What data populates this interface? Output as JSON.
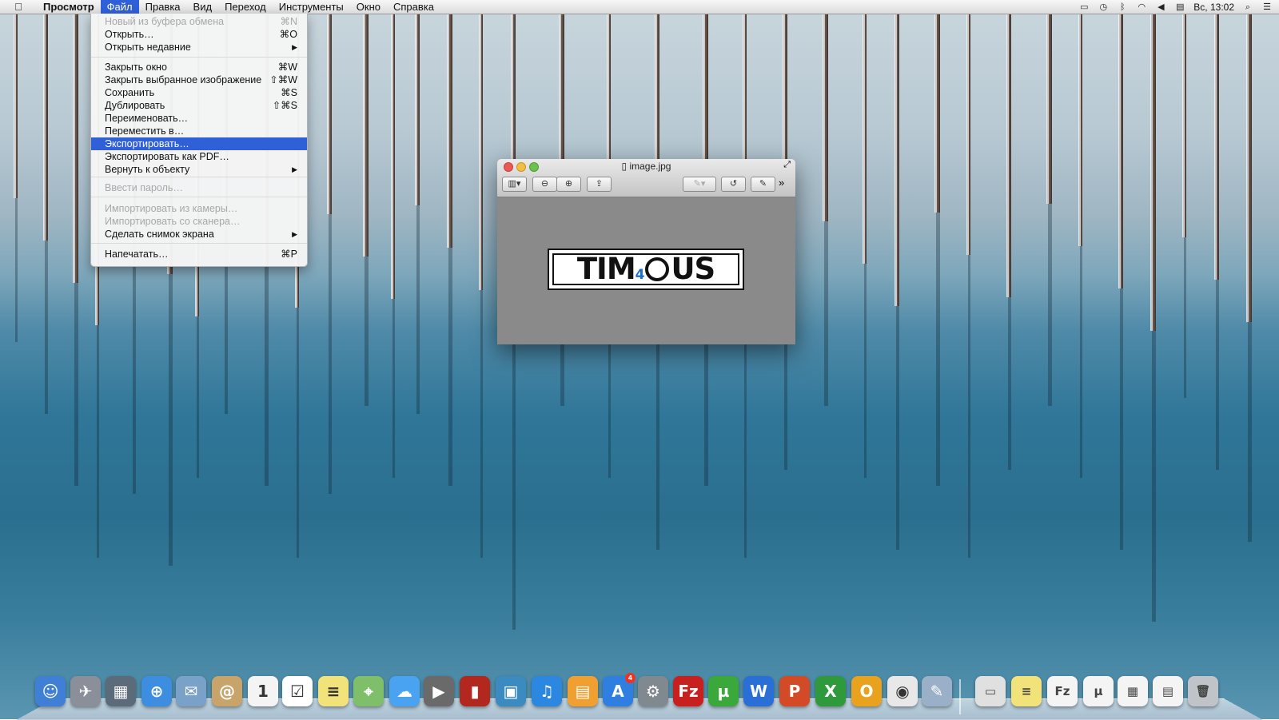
{
  "menubar": {
    "apple_icon": "apple-icon",
    "app_name": "Просмотр",
    "items": [
      "Файл",
      "Правка",
      "Вид",
      "Переход",
      "Инструменты",
      "Окно",
      "Справка"
    ],
    "clock": "Вс, 13:02"
  },
  "file_menu": {
    "items": [
      {
        "label": "Новый из буфера обмена",
        "shortcut": "⌘N",
        "disabled": true
      },
      {
        "label": "Открыть…",
        "shortcut": "⌘O"
      },
      {
        "label": "Открыть недавние",
        "submenu": true
      },
      {
        "label": "Закрыть окно",
        "shortcut": "⌘W"
      },
      {
        "label": "Закрыть выбранное изображение",
        "shortcut": "⇧⌘W"
      },
      {
        "label": "Сохранить",
        "shortcut": "⌘S"
      },
      {
        "label": "Дублировать",
        "shortcut": "⇧⌘S"
      },
      {
        "label": "Переименовать…"
      },
      {
        "label": "Переместить в…"
      },
      {
        "label": "Экспортировать…",
        "highlighted": true
      },
      {
        "label": "Экспортировать как PDF…"
      },
      {
        "label": "Вернуть к объекту",
        "submenu": true
      },
      {
        "label": "Ввести пароль…",
        "disabled": true
      },
      {
        "label": "Импортировать из камеры…",
        "disabled": true
      },
      {
        "label": "Импортировать со сканера…",
        "disabled": true
      },
      {
        "label": "Сделать снимок экрана",
        "submenu": true
      },
      {
        "label": "Напечатать…",
        "shortcut": "⌘P"
      }
    ]
  },
  "preview_window": {
    "title": "image.jpg",
    "logo_text": {
      "part1": "TIM",
      "four": "4",
      "part2": "US"
    }
  },
  "dock": {
    "apps": [
      "Finder",
      "Launchpad",
      "Mission Control",
      "Safari",
      "Mail",
      "Contacts",
      "Calendar",
      "Reminders",
      "Notes",
      "Maps",
      "Messages",
      "FaceTime",
      "Photo Booth",
      "iPhoto",
      "iTunes",
      "iBooks",
      "App Store",
      "System Preferences",
      "FileZilla",
      "uTorrent",
      "Word",
      "PowerPoint",
      "Excel",
      "Outlook",
      "Chrome",
      "Preview",
      "Timous",
      "Notes2",
      "Downloads1",
      "Downloads2",
      "Downloads3",
      "Downloads4",
      "Trash"
    ],
    "calendar_day": "1",
    "appstore_badge": "4"
  },
  "colors": {
    "menu_highlight": "#2f60d8",
    "logo_accent": "#1d6fd0"
  }
}
